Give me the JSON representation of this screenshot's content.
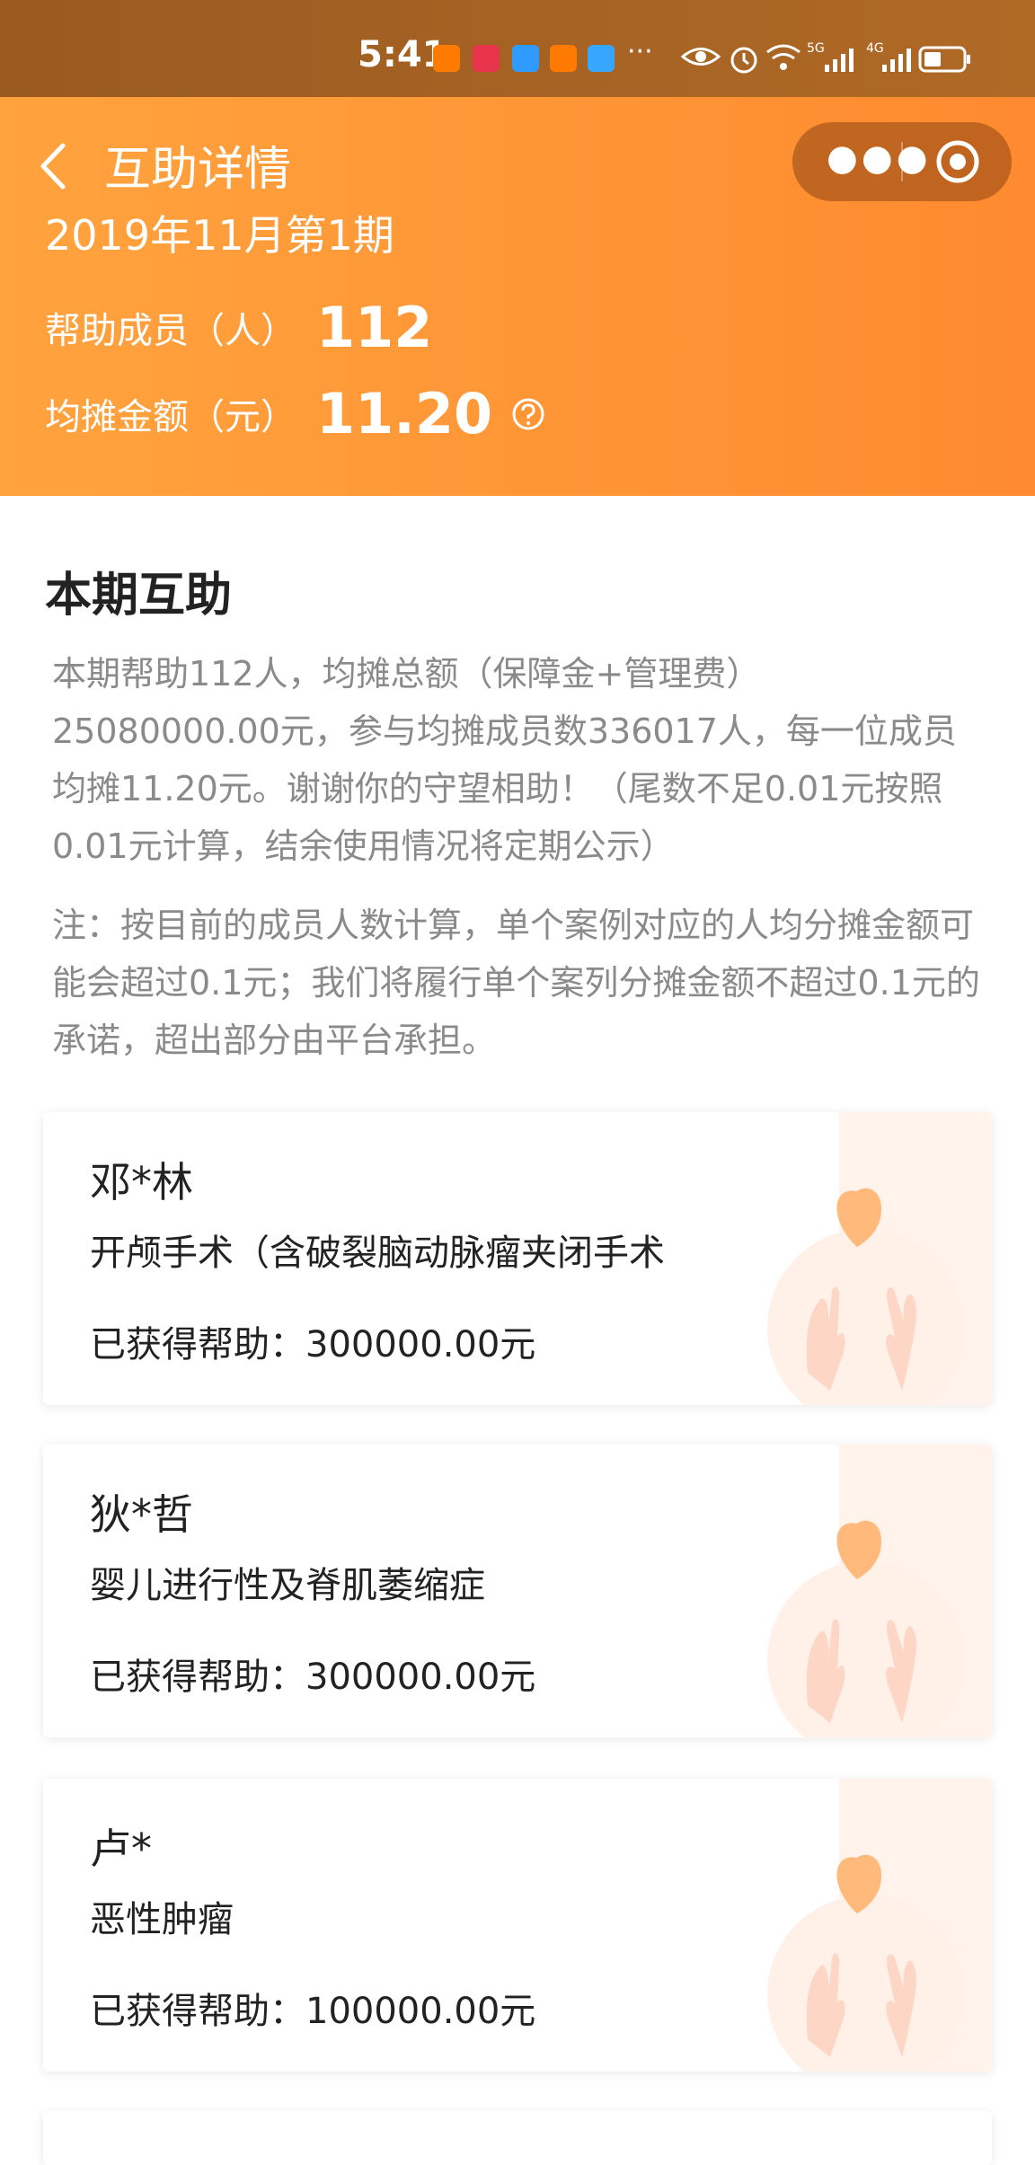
{
  "status_bar": {
    "time": "5:41",
    "app_icons": [
      "1688",
      "HUAWEI",
      "browser",
      "1688",
      "weather"
    ],
    "more": "···",
    "network1": "5G",
    "network2": "4G"
  },
  "header": {
    "title": "互助详情",
    "period": "2019年11月第1期",
    "members_label": "帮助成员（人）",
    "members_value": "112",
    "amount_label": "均摊金额（元）",
    "amount_value": "11.20",
    "colors": {
      "gradient_start": "#ffa33e",
      "gradient_end": "#ff8a2f"
    }
  },
  "capsule": {
    "more_icon": "more-icon",
    "close_icon": "target-icon"
  },
  "section": {
    "title": "本期互助",
    "description": "本期帮助112人，均摊总额（保障金+管理费）25080000.00元，参与均摊成员数336017人，每一位成员均摊11.20元。谢谢你的守望相助！（尾数不足0.01元按照0.01元计算，结余使用情况将定期公示）",
    "note": "注：按目前的成员人数计算，单个案例对应的人均分摊金额可能会超过0.1元；我们将履行单个案列分摊金额不超过0.1元的承诺，超出部分由平台承担。"
  },
  "cases": [
    {
      "name": "邓*林",
      "illness": "开颅手术（含破裂脑动脉瘤夹闭手术",
      "amount_label": "已获得帮助：",
      "amount": "300000.00元"
    },
    {
      "name": "狄*哲",
      "illness": "婴儿进行性及脊肌萎缩症",
      "amount_label": "已获得帮助：",
      "amount": "300000.00元"
    },
    {
      "name": "卢*",
      "illness": "恶性肿瘤",
      "amount_label": "已获得帮助：",
      "amount": "100000.00元"
    }
  ]
}
